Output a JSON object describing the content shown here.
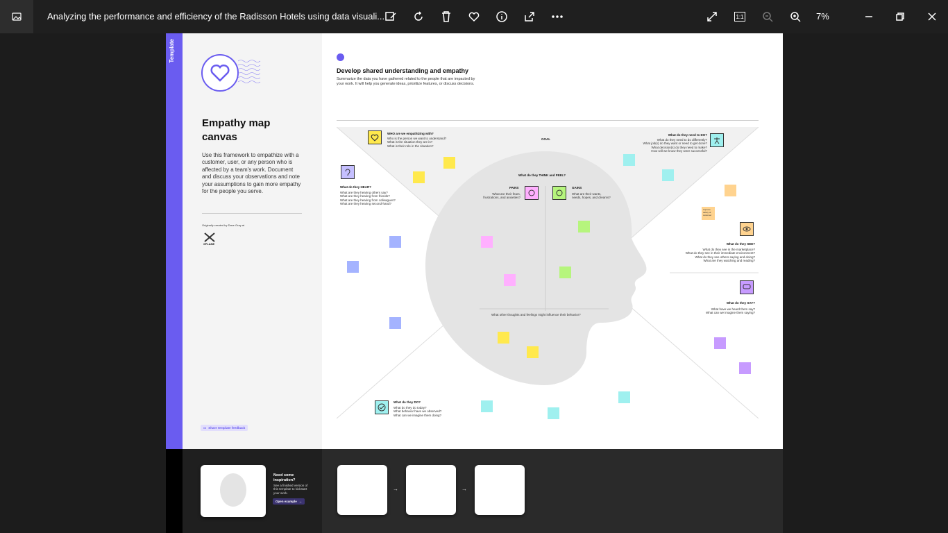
{
  "window": {
    "title": "Analyzing the performance and efficiency of the Radisson Hotels using data visuali...",
    "zoom": "7%"
  },
  "toolbar": {
    "icons": [
      "edit-image-icon",
      "rotate-icon",
      "delete-icon",
      "favorite-icon",
      "info-icon",
      "share-icon",
      "more-icon",
      "expand-icon",
      "actual-size-icon",
      "zoom-out-icon",
      "zoom-in-icon"
    ],
    "actual_size_label": "1:1"
  },
  "template": {
    "strip_label": "Template",
    "title": "Empathy map canvas",
    "description": "Use this framework to empathize with a customer, user, or any person who is affected by a team's work. Document and discuss your observations and note your assumptions to gain more empathy for the people you serve.",
    "credit": "Originally created by Dave Gray at",
    "credit_brand": "XPLANE",
    "feedback_button": "Share template feedback"
  },
  "main": {
    "heading": "Develop shared understanding and empathy",
    "subheading": "Summarize the data you have gathered related to the people that are impacted by your work. It will help you generate ideas, prioritize features, or discuss decisions.",
    "goal": "GOAL",
    "who_title": "WHO are we empathizing with?",
    "who_lines": [
      "Who is the person we want to understand?",
      "What is the situation they are in?",
      "What is their role in the situation?"
    ],
    "need_title": "What do they need to DO?",
    "need_lines": [
      "What do they need to do differently?",
      "What job(s) do they want or need to get done?",
      "What decision(s) do they need to make?",
      "How will we know they were successful?"
    ],
    "hear_title": "What do they HEAR?",
    "hear_lines": [
      "What are they hearing others say?",
      "What are they hearing from friends?",
      "What are they hearing from colleagues?",
      "What are they hearing second-hand?"
    ],
    "think_title": "What do they THINK and FEEL?",
    "pains_title": "PAINS",
    "pains_lines": [
      "What are their fears,",
      "frustrations, and anxieties?"
    ],
    "gains_title": "GAINS",
    "gains_lines": [
      "What are their wants,",
      "needs, hopes, and dreams?"
    ],
    "other_thoughts": "What other thoughts and feelings might influence their behavior?",
    "see_title": "What do they SEE?",
    "see_lines": [
      "What do they see in the marketplace?",
      "What do they see in their immediate environment?",
      "What do they see others saying and doing?",
      "What are they watching and reading?"
    ],
    "say_title": "What do they SAY?",
    "say_lines": [
      "What have we heard them say?",
      "What can we imagine them saying?"
    ],
    "do_title": "What do they DO?",
    "do_lines": [
      "What do they do today?",
      "What behavior have we observed?",
      "What can we imagine them doing?"
    ],
    "sticky_texts": {
      "improve": "Improve safety of customer"
    }
  },
  "bottom": {
    "inspiration_title": "Need some inspiration?",
    "inspiration_text": "See a finished version of this template to kickstart your work.",
    "open_example": "Open example"
  }
}
